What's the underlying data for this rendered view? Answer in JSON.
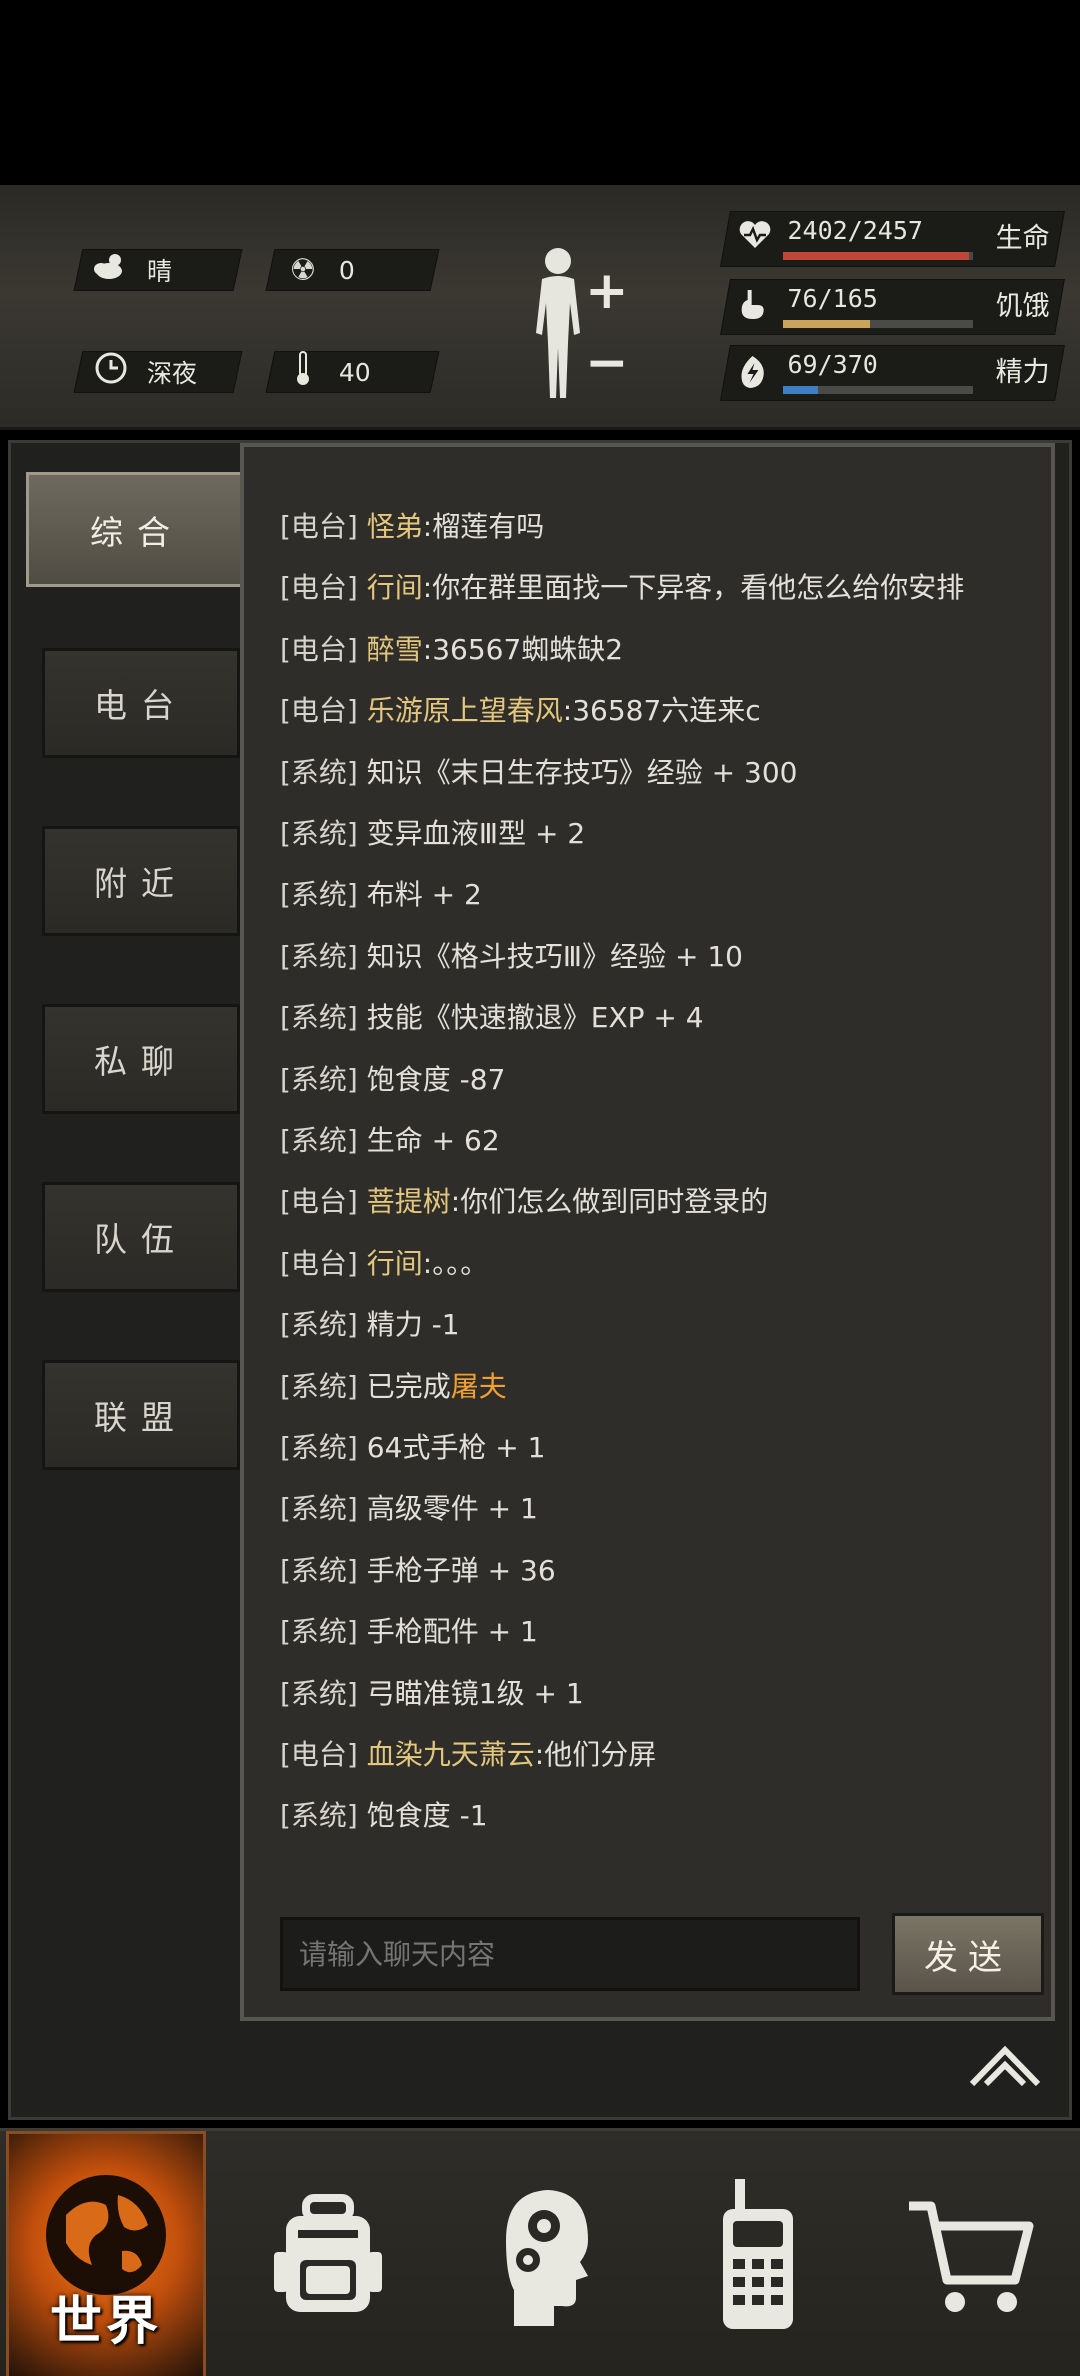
{
  "status": {
    "weather": {
      "icon": "cloudy-sun-icon",
      "label": "晴"
    },
    "radiation": {
      "icon": "radiation-icon",
      "value": "0"
    },
    "time_of_day": {
      "icon": "clock-icon",
      "label": "深夜"
    },
    "temperature": {
      "icon": "thermometer-icon",
      "value": "40"
    }
  },
  "stats": {
    "health": {
      "icon": "heart-icon",
      "value": "2402/2457",
      "label": "生命",
      "fraction": 0.978,
      "color": "#c0483a"
    },
    "hunger": {
      "icon": "stomach-icon",
      "value": "76/165",
      "label": "饥饿",
      "fraction": 0.46,
      "color": "#c9a45a"
    },
    "energy": {
      "icon": "energy-icon",
      "value": "69/370",
      "label": "精力",
      "fraction": 0.186,
      "color": "#3e7fc4"
    }
  },
  "tabs": [
    "综合",
    "电台",
    "附近",
    "私聊",
    "队伍",
    "联盟"
  ],
  "active_tab": "综合",
  "messages": [
    {
      "channel": "[电台]",
      "name": "怪弟",
      "text": ":榴莲有吗"
    },
    {
      "channel": "[电台]",
      "name": "行间",
      "text": ":你在群里面找一下异客，看他怎么给你安排"
    },
    {
      "channel": "[电台]",
      "name": "醉雪",
      "text": ":36567蜘蛛缺2"
    },
    {
      "channel": "[电台]",
      "name": "乐游原上望春风",
      "text": ":36587六连来c"
    },
    {
      "channel": "[系统]",
      "text": "知识《末日生存技巧》经验 + 300"
    },
    {
      "channel": "[系统]",
      "text": "变异血液Ⅲ型 + 2"
    },
    {
      "channel": "[系统]",
      "text": "布料 + 2"
    },
    {
      "channel": "[系统]",
      "text": "知识《格斗技巧Ⅲ》经验 + 10"
    },
    {
      "channel": "[系统]",
      "text": "技能《快速撤退》EXP + 4"
    },
    {
      "channel": "[系统]",
      "text": "饱食度 -87"
    },
    {
      "channel": "[系统]",
      "text": "生命 + 62"
    },
    {
      "channel": "[电台]",
      "name": "菩提树",
      "text": ":你们怎么做到同时登录的"
    },
    {
      "channel": "[电台]",
      "name": "行间",
      "text": ":。。。"
    },
    {
      "channel": "[系统]",
      "text": "精力 -1"
    },
    {
      "channel": "[系统]",
      "text": "已完成",
      "highlight": "屠夫"
    },
    {
      "channel": "[系统]",
      "text": "64式手枪 + 1"
    },
    {
      "channel": "[系统]",
      "text": "高级零件 + 1"
    },
    {
      "channel": "[系统]",
      "text": "手枪子弹 + 36"
    },
    {
      "channel": "[系统]",
      "text": "手枪配件 + 1"
    },
    {
      "channel": "[系统]",
      "text": "弓瞄准镜1级 + 1"
    },
    {
      "channel": "[电台]",
      "name": "血染九天萧云",
      "text": ":他们分屏"
    },
    {
      "channel": "[系统]",
      "text": "饱食度 -1"
    }
  ],
  "chat_input": {
    "placeholder": "请输入聊天内容",
    "value": ""
  },
  "send_label": "发送",
  "nav": [
    {
      "label": "世界",
      "icon": "globe-icon"
    },
    {
      "icon": "backpack-icon"
    },
    {
      "icon": "head-gears-icon"
    },
    {
      "icon": "walkie-talkie-icon"
    },
    {
      "icon": "shopping-cart-icon"
    }
  ]
}
